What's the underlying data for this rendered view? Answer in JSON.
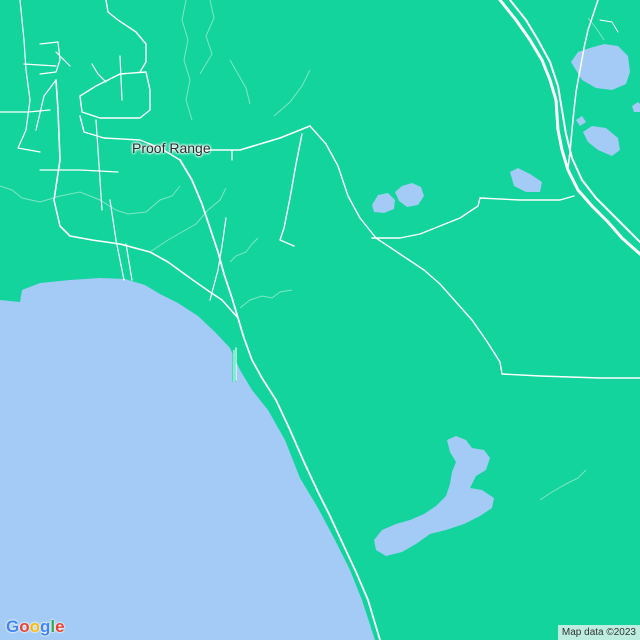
{
  "map": {
    "place_label": "Proof Range",
    "attribution": "Map data ©2023",
    "logo_letters": [
      {
        "ch": "G",
        "color": "#4285F4"
      },
      {
        "ch": "o",
        "color": "#EA4335"
      },
      {
        "ch": "o",
        "color": "#FBBC05"
      },
      {
        "ch": "g",
        "color": "#4285F4"
      },
      {
        "ch": "l",
        "color": "#34A853"
      },
      {
        "ch": "e",
        "color": "#EA4335"
      }
    ],
    "colors": {
      "land": "#12d49c",
      "water": "#a3cbf5",
      "road": "#ffffff",
      "stream": "#7fe6c6"
    }
  }
}
